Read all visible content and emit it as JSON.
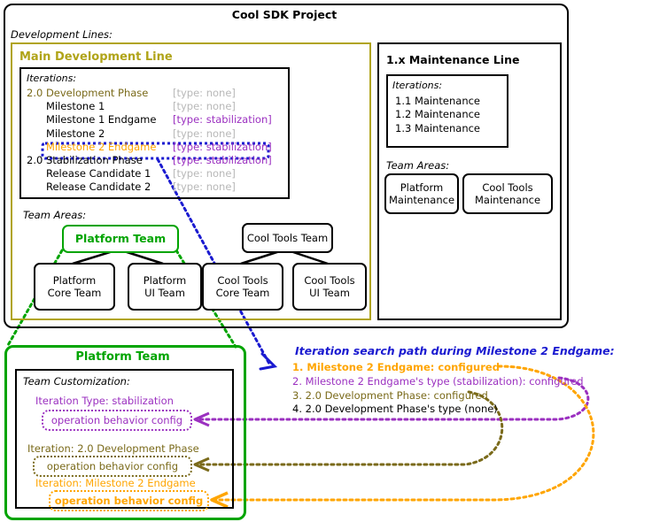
{
  "project": {
    "title": "Cool SDK Project",
    "dev_lines_label": "Development Lines:"
  },
  "main_line": {
    "title": "Main Development Line",
    "iterations_label": "Iterations:",
    "iterations": [
      {
        "name": "2.0 Development Phase",
        "type": "[type: none]",
        "indent": 0,
        "name_color": "#7a6a1a",
        "type_color": "#b8b8b8",
        "highlight": false
      },
      {
        "name": "Milestone 1",
        "type": "[type: none]",
        "indent": 1,
        "name_color": "#000000",
        "type_color": "#b8b8b8",
        "highlight": false
      },
      {
        "name": "Milestone 1 Endgame",
        "type": "[type: stabilization]",
        "indent": 1,
        "name_color": "#000000",
        "type_color": "#9b30c0",
        "highlight": false
      },
      {
        "name": "Milestone 2",
        "type": "[type: none]",
        "indent": 1,
        "name_color": "#000000",
        "type_color": "#b8b8b8",
        "highlight": false
      },
      {
        "name": "Milestone 2 Endgame",
        "type": "[type: stabilization]",
        "indent": 1,
        "name_color": "#ffa500",
        "type_color": "#9b30c0",
        "highlight": true
      },
      {
        "name": "2.0 Stabilization Phase",
        "type": "[type: stabilization]",
        "indent": 0,
        "name_color": "#000000",
        "type_color": "#9b30c0",
        "highlight": false
      },
      {
        "name": "Release Candidate 1",
        "type": "[type: none]",
        "indent": 1,
        "name_color": "#000000",
        "type_color": "#b8b8b8",
        "highlight": false
      },
      {
        "name": "Release Candidate 2",
        "type": "[type: none]",
        "indent": 1,
        "name_color": "#000000",
        "type_color": "#b8b8b8",
        "highlight": false
      }
    ],
    "team_areas_label": "Team Areas:",
    "teams": {
      "platform_team": "Platform Team",
      "platform_core": "Platform\nCore Team",
      "platform_core_l1": "Platform",
      "platform_core_l2": "Core Team",
      "platform_ui_l1": "Platform",
      "platform_ui_l2": "UI Team",
      "cool_tools_team": "Cool Tools Team",
      "cool_tools_core_l1": "Cool Tools",
      "cool_tools_core_l2": "Core Team",
      "cool_tools_ui_l1": "Cool Tools",
      "cool_tools_ui_l2": "UI Team"
    }
  },
  "maintenance_line": {
    "title": "1.x Maintenance Line",
    "iterations_label": "Iterations:",
    "iterations": [
      "1.1 Maintenance",
      "1.2 Maintenance",
      "1.3 Maintenance"
    ],
    "team_areas_label": "Team Areas:",
    "teams": {
      "platform_l1": "Platform",
      "platform_l2": "Maintenance",
      "cool_tools_l1": "Cool Tools",
      "cool_tools_l2": "Maintenance"
    }
  },
  "platform_team_detail": {
    "title": "Platform Team",
    "customization_label": "Team Customization:",
    "entries": [
      {
        "heading": "Iteration Type: stabilization",
        "config": "operation behavior config",
        "color": "#9b30c0"
      },
      {
        "heading": "Iteration: 2.0 Development Phase",
        "config": "operation behavior config",
        "color": "#7a6a1a"
      },
      {
        "heading": "Iteration: Milestone 2 Endgame",
        "config": "operation behavior config",
        "color": "#ffa500"
      }
    ]
  },
  "legend": {
    "title": "Iteration search path during Milestone 2 Endgame:",
    "steps": [
      {
        "text": "1. Milestone 2 Endgame: configured",
        "color": "#ffa500"
      },
      {
        "text": "2. Milestone 2 Endgame's type (stabilization): configured",
        "color": "#9b30c0"
      },
      {
        "text": "3. 2.0 Development Phase: configured",
        "color": "#7a6a1a"
      },
      {
        "text": "4. 2.0 Development Phase's type (none)",
        "color": "#000000"
      }
    ]
  },
  "colors": {
    "mainline_border": "#b0a419",
    "green": "#00a400",
    "blue": "#1a1ad0",
    "purple": "#9b30c0",
    "olive": "#7a6a1a",
    "orange": "#ffa500",
    "grey_text": "#b8b8b8"
  }
}
